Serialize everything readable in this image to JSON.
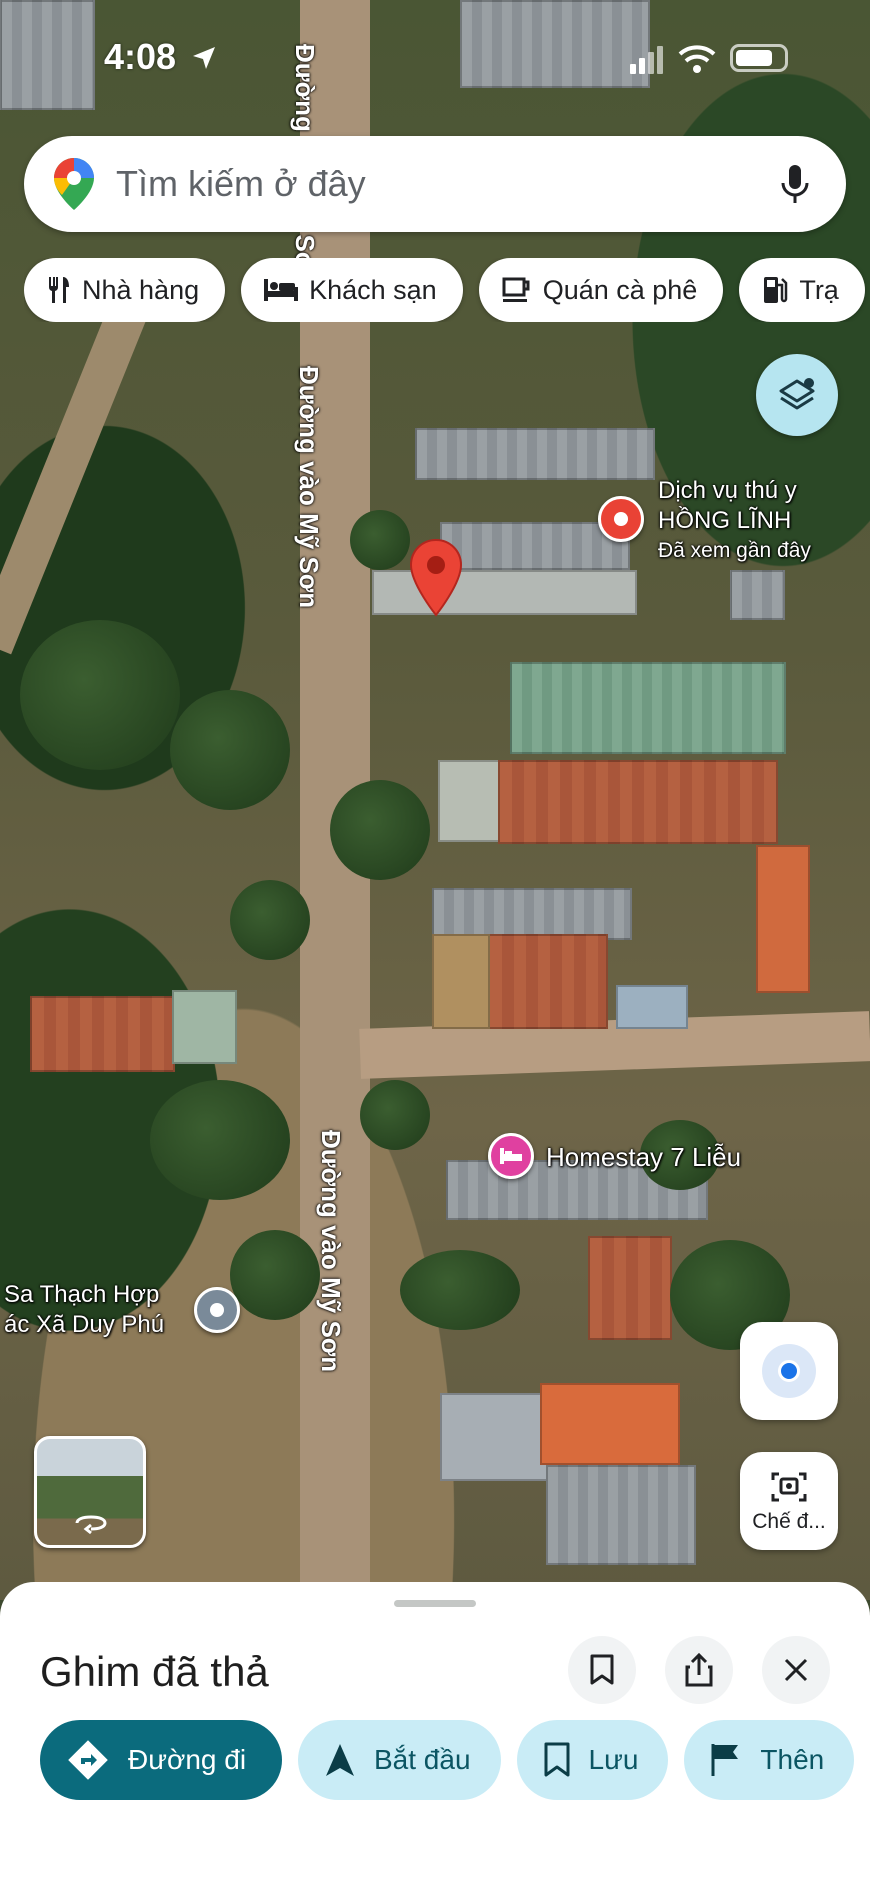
{
  "status_bar": {
    "time": "4:08"
  },
  "search": {
    "placeholder": "Tìm kiếm ở đây"
  },
  "chips": [
    {
      "label": "Nhà hàng",
      "icon": "restaurant-icon"
    },
    {
      "label": "Khách sạn",
      "icon": "hotel-icon"
    },
    {
      "label": "Quán cà phê",
      "icon": "coffee-icon"
    },
    {
      "label": "Trạ",
      "icon": "gas-station-icon"
    }
  ],
  "map": {
    "street_labels": [
      "Đường vào Mỹ Sơn",
      "Đường vào Mỹ Sơn",
      "Đường vào Mỹ Sơn"
    ],
    "pois": [
      {
        "name_line1": "Dịch vụ thú y",
        "name_line2": "HỒNG LĨNH",
        "note": "Đã xem gần đây",
        "color": "#e94235"
      },
      {
        "name": "Homestay 7 Liễu",
        "color": "#e040a0"
      },
      {
        "name_line1": "Sa Thạch Hợp",
        "name_line2": "ác Xã Duy Phú",
        "color": "#7a8a99"
      }
    ],
    "camera_mode_label": "Chế đ..."
  },
  "sheet": {
    "title": "Ghim đã thả",
    "actions": [
      {
        "label": "Đường đi",
        "icon": "directions-icon"
      },
      {
        "label": "Bắt đầu",
        "icon": "navigation-arrow-icon"
      },
      {
        "label": "Lưu",
        "icon": "bookmark-icon"
      },
      {
        "label": "Thên",
        "icon": "flag-icon"
      }
    ]
  },
  "colors": {
    "accent": "#0b6b7d",
    "chip_bg": "#c9ecf6",
    "pin_red": "#ea4335"
  }
}
